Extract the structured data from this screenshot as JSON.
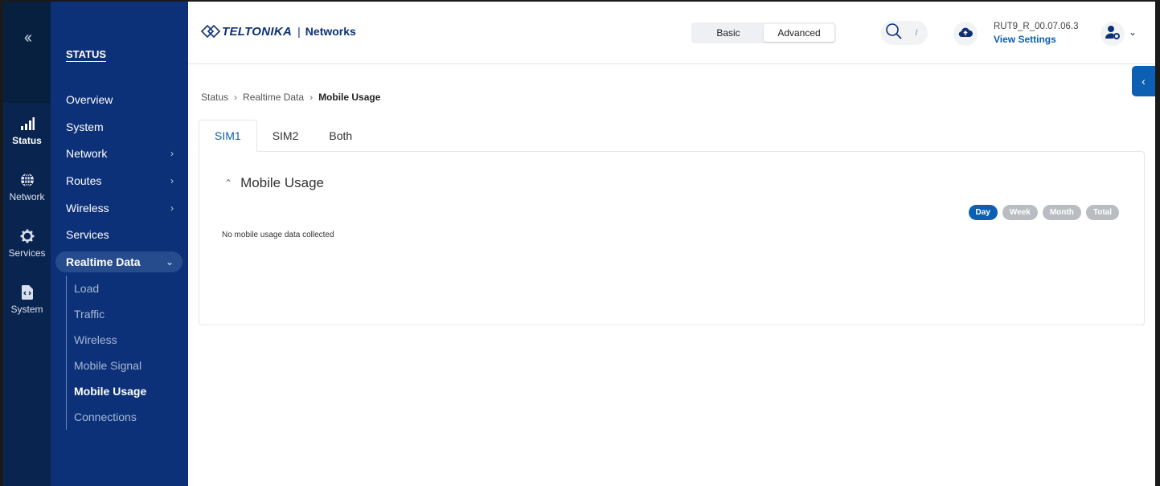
{
  "rail": {
    "items": [
      {
        "label": "Status",
        "icon": "signal-bars-icon"
      },
      {
        "label": "Network",
        "icon": "globe-icon"
      },
      {
        "label": "Services",
        "icon": "gear-icon"
      },
      {
        "label": "System",
        "icon": "file-code-icon"
      }
    ]
  },
  "nav": {
    "heading": "STATUS",
    "items": [
      {
        "label": "Overview"
      },
      {
        "label": "System"
      },
      {
        "label": "Network"
      },
      {
        "label": "Routes"
      },
      {
        "label": "Wireless"
      },
      {
        "label": "Services"
      },
      {
        "label": "Realtime Data"
      }
    ],
    "sub_items": [
      {
        "label": "Load"
      },
      {
        "label": "Traffic"
      },
      {
        "label": "Wireless"
      },
      {
        "label": "Mobile Signal"
      },
      {
        "label": "Mobile Usage"
      },
      {
        "label": "Connections"
      }
    ]
  },
  "header": {
    "logo_text": "TELTONIKA",
    "logo_sep": "|",
    "logo_sub": "Networks",
    "mode_basic": "Basic",
    "mode_advanced": "Advanced",
    "search_shortcut": "/",
    "firmware": "RUT9_R_00.07.06.3",
    "view_settings": "View Settings"
  },
  "breadcrumb": {
    "items": [
      "Status",
      "Realtime Data",
      "Mobile Usage"
    ]
  },
  "tabs": [
    "SIM1",
    "SIM2",
    "Both"
  ],
  "card": {
    "title": "Mobile Usage",
    "periods": [
      "Day",
      "Week",
      "Month",
      "Total"
    ],
    "empty_message": "No mobile usage data collected"
  },
  "colors": {
    "rail_bg": "#0a2450",
    "nav_bg": "#0d3178",
    "accent": "#0d5fb3",
    "pill_inactive": "#b9bdc2"
  }
}
